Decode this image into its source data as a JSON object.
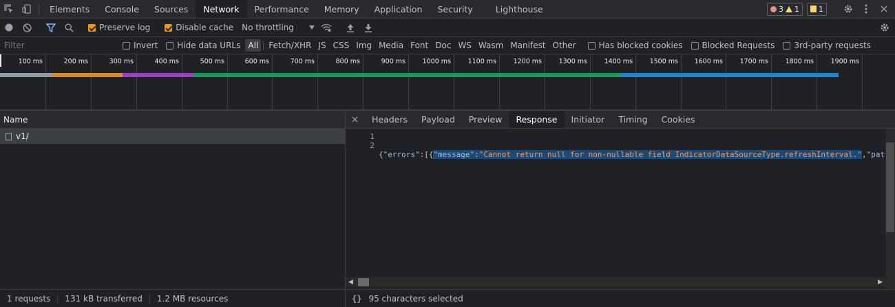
{
  "tabs": {
    "items": [
      "Elements",
      "Console",
      "Sources",
      "Network",
      "Performance",
      "Memory",
      "Application",
      "Security",
      "Lighthouse"
    ],
    "active": "Network"
  },
  "badges": {
    "errors": "3",
    "warnings": "1",
    "issues": "1"
  },
  "toolbar": {
    "preserve_log": "Preserve log",
    "disable_cache": "Disable cache",
    "throttling": "No throttling"
  },
  "filterbar": {
    "filter_placeholder": "Filter",
    "invert": "Invert",
    "hide_data_urls": "Hide data URLs",
    "types": [
      "All",
      "Fetch/XHR",
      "JS",
      "CSS",
      "Img",
      "Media",
      "Font",
      "Doc",
      "WS",
      "Wasm",
      "Manifest",
      "Other"
    ],
    "selected_type": "All",
    "blocked_cookies": "Has blocked cookies",
    "blocked_requests": "Blocked Requests",
    "third_party": "3rd-party requests"
  },
  "timeline": {
    "ticks": [
      "100 ms",
      "200 ms",
      "300 ms",
      "400 ms",
      "500 ms",
      "600 ms",
      "700 ms",
      "800 ms",
      "900 ms",
      "1000 ms",
      "1100 ms",
      "1200 ms",
      "1300 ms",
      "1400 ms",
      "1500 ms",
      "1600 ms",
      "1700 ms",
      "1800 ms",
      "1900 ms",
      "200"
    ]
  },
  "requests": {
    "header": "Name",
    "rows": [
      {
        "name": "v1/"
      }
    ]
  },
  "status": {
    "requests": "1 requests",
    "transferred": "131 kB transferred",
    "resources": "1.2 MB resources"
  },
  "detail": {
    "tabs": [
      "Headers",
      "Payload",
      "Preview",
      "Response",
      "Initiator",
      "Timing",
      "Cookies"
    ],
    "active": "Response",
    "line_numbers": [
      "1",
      "2"
    ],
    "code": {
      "p1": "{",
      "key_errors": "\"errors\"",
      "p2": ":[{",
      "key_message": "\"message\"",
      "p3": ":",
      "value_message": "\"Cannot return null for non-nullable field IndicatorDataSourceType.refreshInterval.\"",
      "p4": ",",
      "key_path": "\"path\""
    },
    "status_icon": "{}",
    "status_text": "95 characters selected"
  }
}
